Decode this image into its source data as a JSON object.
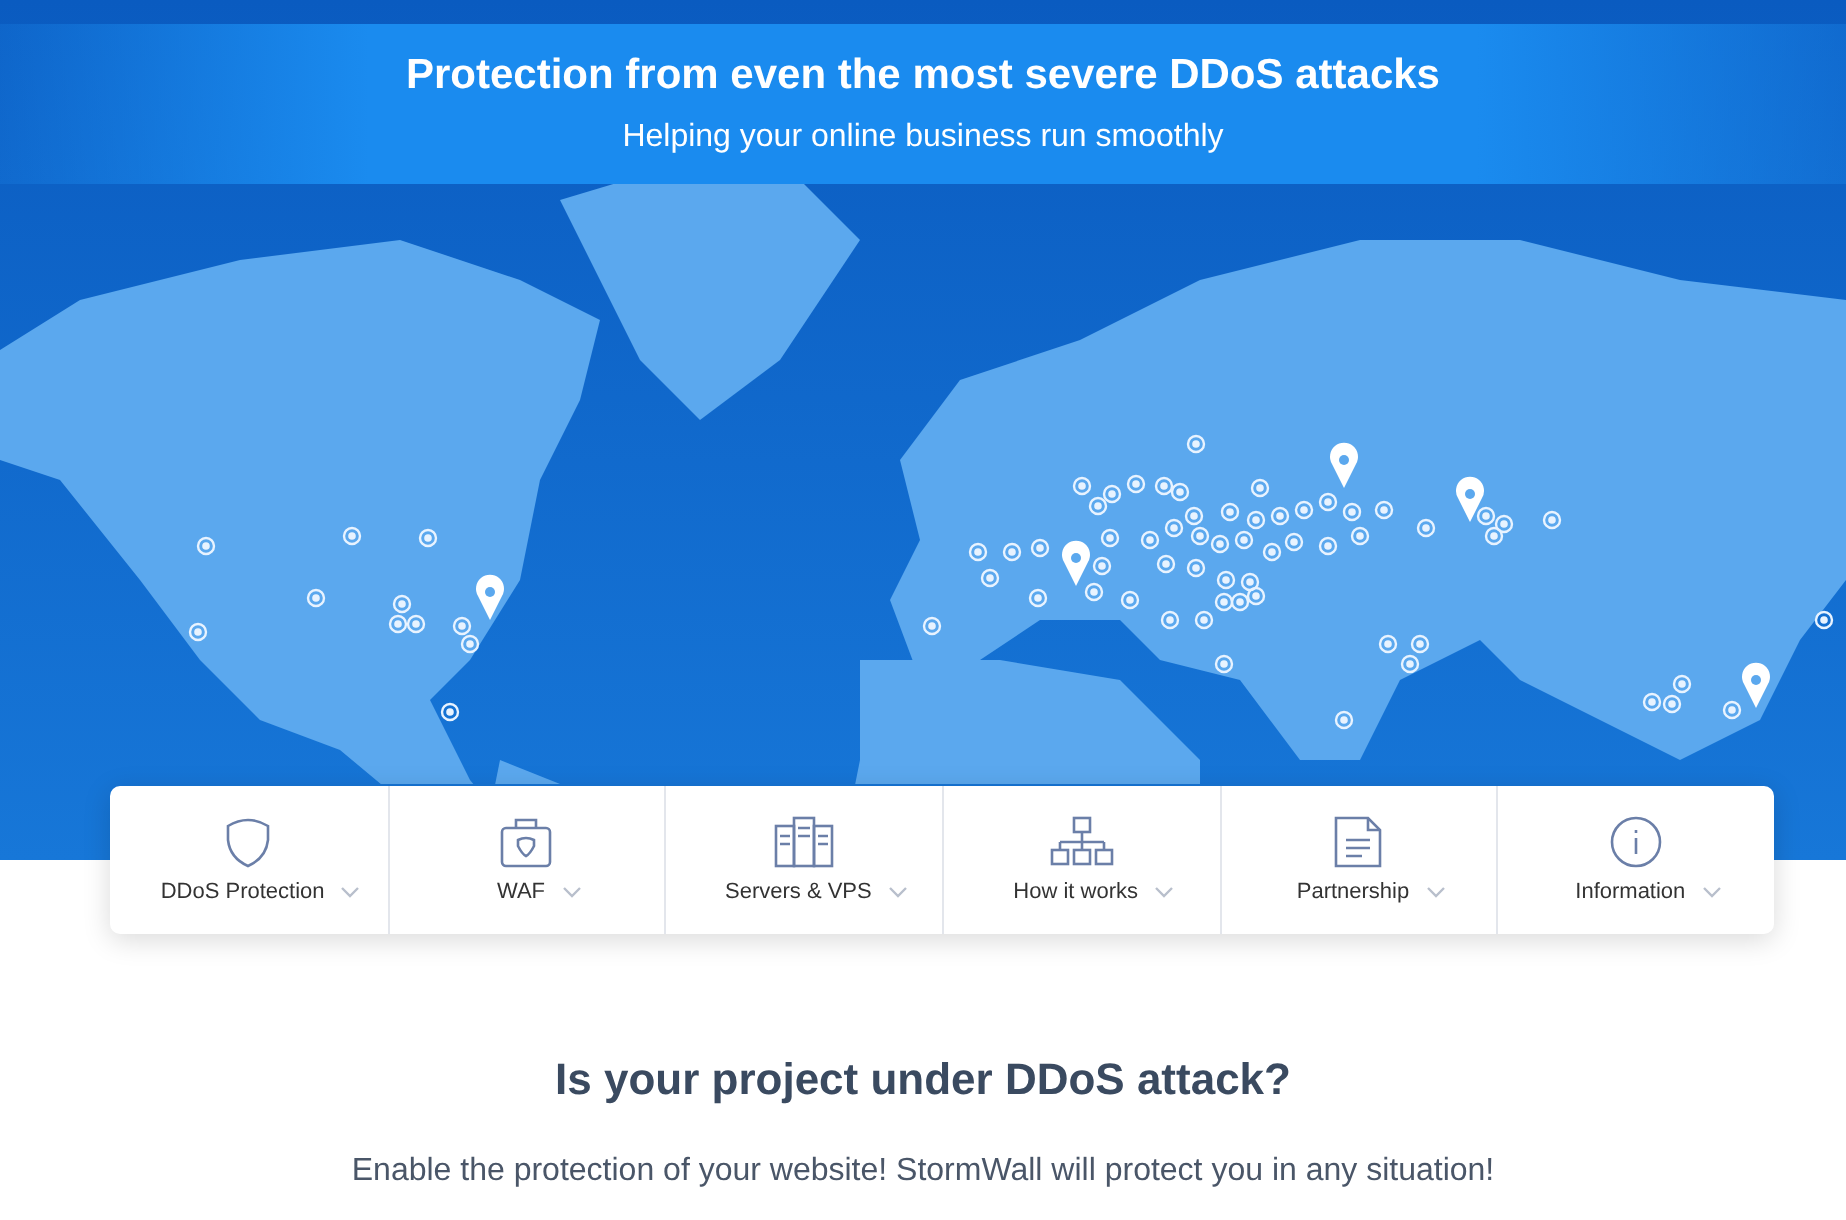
{
  "hero": {
    "title": "Protection from even the most severe DDoS attacks",
    "subtitle": "Helping your online business run smoothly"
  },
  "nav": [
    {
      "kind": "shield",
      "label": "DDoS Protection"
    },
    {
      "kind": "case",
      "label": "WAF"
    },
    {
      "kind": "servers",
      "label": "Servers & VPS"
    },
    {
      "kind": "tree",
      "label": "How it works"
    },
    {
      "kind": "document",
      "label": "Partnership"
    },
    {
      "kind": "info",
      "label": "Information"
    }
  ],
  "cta": {
    "heading": "Is your project under DDoS attack?",
    "text": "Enable the protection of your website! StormWall will protect you in any situation!"
  }
}
